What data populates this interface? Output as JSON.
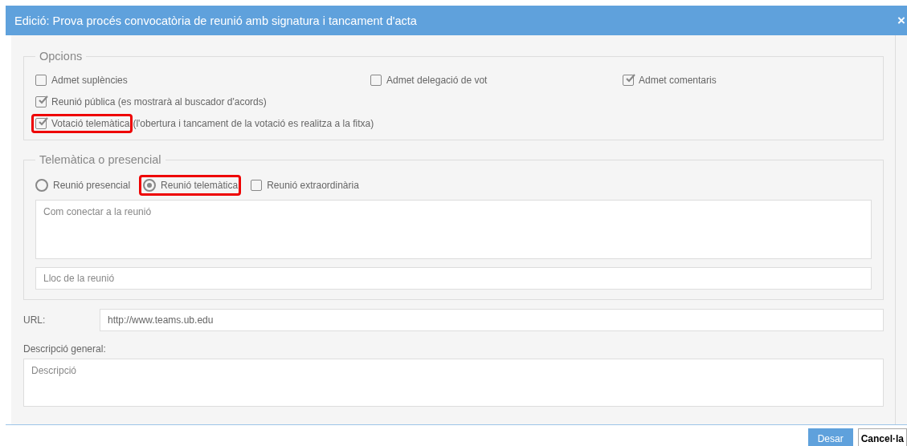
{
  "window": {
    "title": "Edició: Prova procés convocatòria de reunió amb signatura i tancament d'acta",
    "close": "×"
  },
  "options": {
    "legend": "Opcions",
    "items": [
      {
        "kind": "checkbox",
        "label": "Admet suplències",
        "checked": false,
        "highlighted": false
      },
      {
        "kind": "checkbox",
        "label": "Admet delegació de vot",
        "checked": false,
        "highlighted": false
      },
      {
        "kind": "checkbox",
        "label": "Admet comentaris",
        "checked": true,
        "highlighted": false
      },
      {
        "kind": "checkbox",
        "label": "Reunió pública (es mostrarà al buscador d'acords)",
        "checked": true,
        "highlighted": false
      },
      {
        "kind": "checkbox",
        "label": "Votació telemàtica",
        "note": "(l'obertura i tancament de la votació es realitza a la fitxa)",
        "checked": true,
        "highlighted": true
      }
    ]
  },
  "mode": {
    "legend": "Telemàtica o presencial",
    "items": [
      {
        "kind": "radio",
        "label": "Reunió presencial",
        "selected": false,
        "highlighted": false
      },
      {
        "kind": "radio",
        "label": "Reunió telemàtica",
        "selected": true,
        "highlighted": true
      },
      {
        "kind": "checkbox",
        "label": "Reunió extraordinària",
        "checked": false,
        "highlighted": false
      }
    ],
    "connect": {
      "placeholder": "Com conectar a la reunió"
    },
    "place": {
      "placeholder": "Lloc de la reunió"
    }
  },
  "url": {
    "label": "URL:",
    "value": "http://www.teams.ub.edu"
  },
  "description": {
    "label": "Descripció general:",
    "placeholder": "Descripció"
  },
  "buttons": [
    {
      "kind": "primary",
      "label": "Desar"
    },
    {
      "kind": "secondary",
      "label": "Cancel·la"
    }
  ]
}
